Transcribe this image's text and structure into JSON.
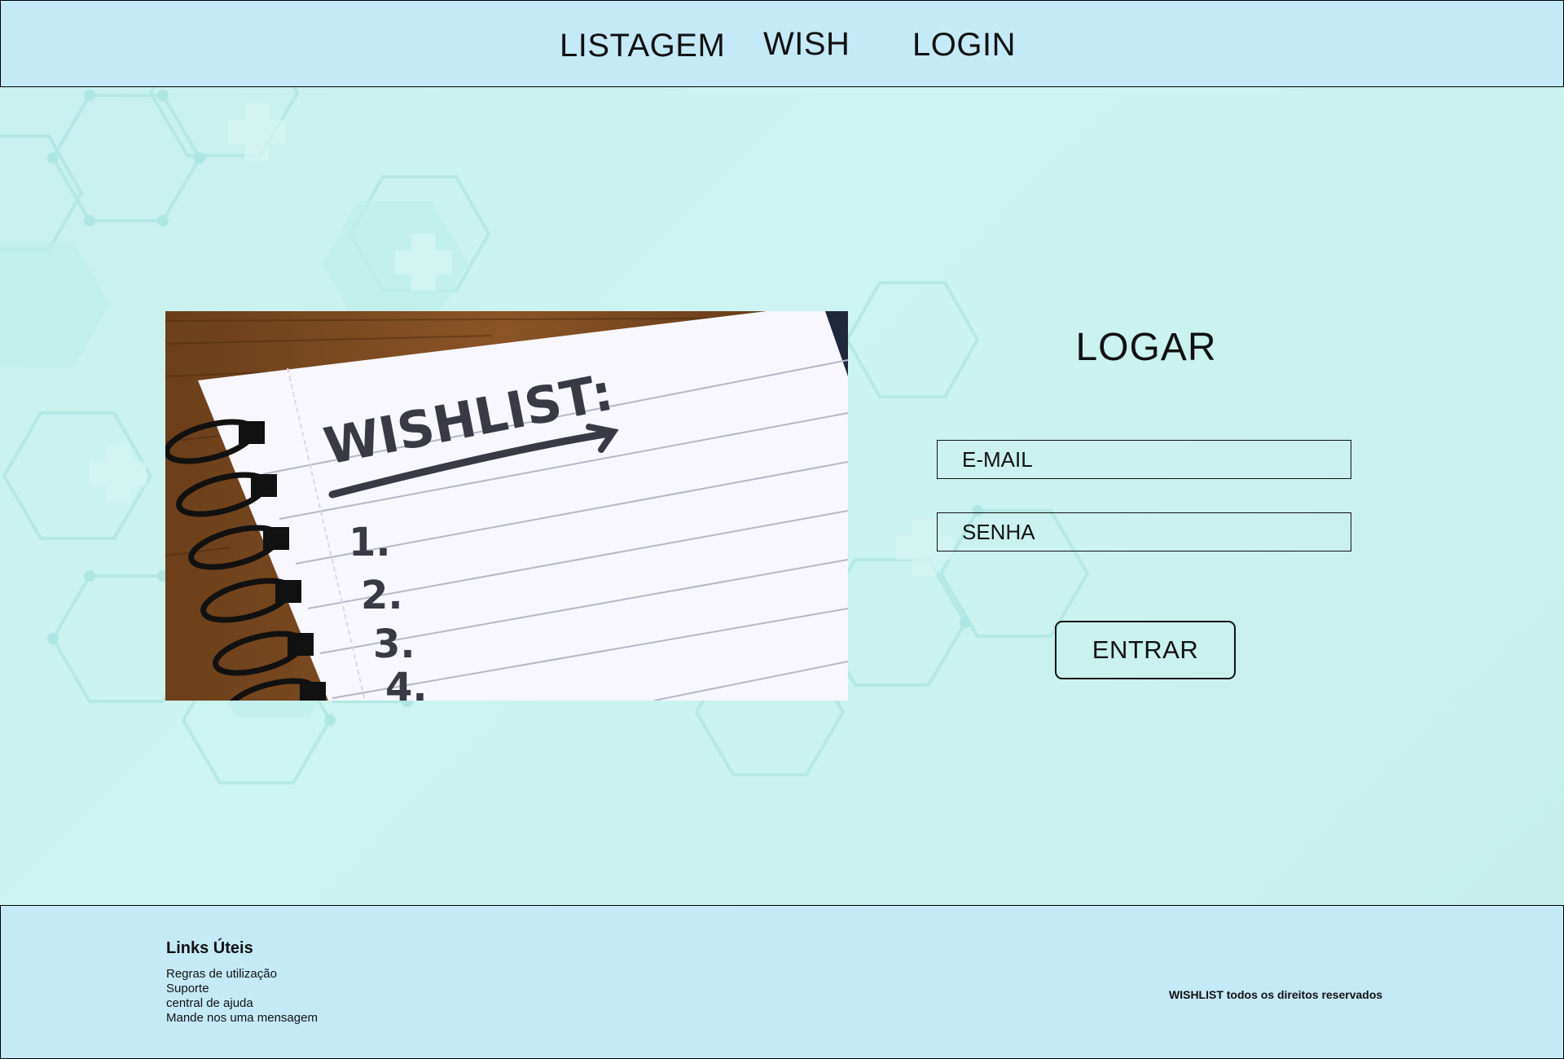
{
  "header": {
    "nav": [
      {
        "label": "LISTAGEM"
      },
      {
        "label": "WISH"
      },
      {
        "label": "LOGIN"
      }
    ]
  },
  "hero_image": {
    "heading": "WISHLIST:",
    "items": [
      "1.",
      "2.",
      "3.",
      "4."
    ]
  },
  "login": {
    "title": "LOGAR",
    "email_placeholder": "E-MAIL",
    "password_placeholder": "SENHA",
    "submit_label": "ENTRAR"
  },
  "footer": {
    "heading": "Links Úteis",
    "links": [
      {
        "label": "Regras de utilização"
      },
      {
        "label": "Suporte"
      },
      {
        "label": "central de ajuda"
      },
      {
        "label": "Mande nos uma mensagem"
      }
    ],
    "copyright": "WISHLIST todos os direitos reservados"
  },
  "colors": {
    "header_bg": "#c4eaf8",
    "page_bg": "#c9f1ee",
    "footer_bg": "#c4eaf8",
    "text": "#111111"
  }
}
